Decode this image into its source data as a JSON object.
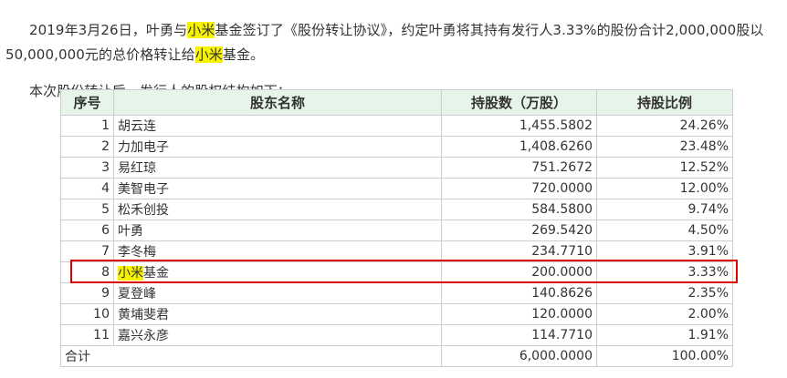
{
  "intro": {
    "p1_a": "2019年3月26日，叶勇与",
    "p1_hl1": "小米",
    "p1_b": "基金签订了《股份转让协议》，约定叶勇将其持有发行人3.33%的股份合计2,000,000股以50,000,000元的总价格转让给",
    "p1_hl2": "小米",
    "p1_c": "基金。",
    "p2": "本次股份转让后，发行人的股权结构如下："
  },
  "table": {
    "headers": [
      "序号",
      "股东名称",
      "持股数（万股）",
      "持股比例"
    ],
    "rows": [
      {
        "no": "1",
        "name": "胡云连",
        "shares": "1,455.5802",
        "ratio": "24.26%"
      },
      {
        "no": "2",
        "name": "力加电子",
        "shares": "1,408.6260",
        "ratio": "23.48%"
      },
      {
        "no": "3",
        "name": "易红琼",
        "shares": "751.2672",
        "ratio": "12.52%"
      },
      {
        "no": "4",
        "name": "美智电子",
        "shares": "720.0000",
        "ratio": "12.00%"
      },
      {
        "no": "5",
        "name": "松禾创投",
        "shares": "584.5800",
        "ratio": "9.74%"
      },
      {
        "no": "6",
        "name": "叶勇",
        "shares": "269.5420",
        "ratio": "4.50%"
      },
      {
        "no": "7",
        "name": "李冬梅",
        "shares": "234.7710",
        "ratio": "3.91%"
      },
      {
        "no": "8",
        "name_hl": "小米",
        "name_rest": "基金",
        "shares": "200.0000",
        "ratio": "3.33%"
      },
      {
        "no": "9",
        "name": "夏登峰",
        "shares": "140.8626",
        "ratio": "2.35%"
      },
      {
        "no": "10",
        "name": "黄埔斐君",
        "shares": "120.0000",
        "ratio": "2.00%"
      },
      {
        "no": "11",
        "name": "嘉兴永彦",
        "shares": "114.7710",
        "ratio": "1.91%"
      }
    ],
    "total": {
      "label": "合计",
      "shares": "6,000.0000",
      "ratio": "100.00%"
    }
  },
  "colors": {
    "highlight": "#f7f200",
    "header_bg": "#e7f4ea",
    "annotation_box": "#e00000"
  }
}
